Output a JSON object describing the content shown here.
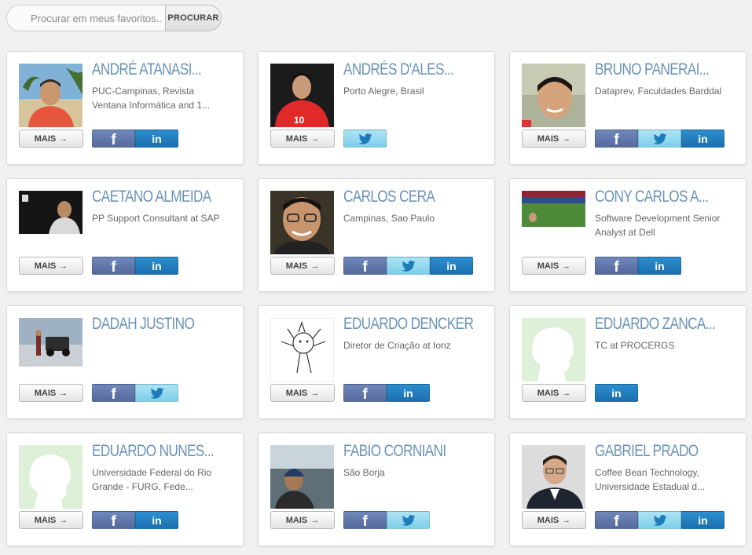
{
  "search": {
    "placeholder": "Procurar em meus favoritos..",
    "button_label": "PROCURAR"
  },
  "more_label": "MAIS",
  "arrow": "→",
  "icons": {
    "facebook": "f",
    "linkedin": "in"
  },
  "colors": {
    "name": "#6a93b8",
    "facebook": "#5f77ad",
    "twitter": "#8ad6ee",
    "linkedin": "#237fc0"
  },
  "profiles": [
    {
      "name": "ANDRÉ ATANASI...",
      "desc": "PUC-Campinas, Revista Ventana Informática and 1...",
      "networks": [
        "facebook",
        "linkedin"
      ],
      "avatar": "photo-beach"
    },
    {
      "name": "ANDRÉS D'ALES...",
      "desc": "Porto Alegre, Brasil",
      "networks": [
        "twitter"
      ],
      "avatar": "photo-red-jersey"
    },
    {
      "name": "BRUNO PANERAI...",
      "desc": "Dataprev, Faculdades Barddal",
      "networks": [
        "facebook",
        "twitter",
        "linkedin"
      ],
      "avatar": "photo-portrait"
    },
    {
      "name": "CAETANO ALMEIDA",
      "desc": "PP Support Consultant at SAP",
      "networks": [
        "facebook",
        "linkedin"
      ],
      "avatar": "photo-night"
    },
    {
      "name": "CARLOS CERA",
      "desc": "Campinas, Sao Paulo",
      "networks": [
        "facebook",
        "twitter",
        "linkedin"
      ],
      "avatar": "photo-glasses"
    },
    {
      "name": "CONY CARLOS A...",
      "desc": "Software Development Senior Analyst at Dell",
      "networks": [
        "facebook",
        "linkedin"
      ],
      "avatar": "photo-stadium"
    },
    {
      "name": "DADAH JUSTINO",
      "desc": "",
      "networks": [
        "facebook",
        "twitter"
      ],
      "avatar": "photo-jeep"
    },
    {
      "name": "EDUARDO DENCKER",
      "desc": "Diretor de Criação at Ionz",
      "networks": [
        "facebook",
        "linkedin"
      ],
      "avatar": "drawing"
    },
    {
      "name": "EDUARDO ZANCA...",
      "desc": "TC at PROCERGS",
      "networks": [
        "linkedin"
      ],
      "avatar": "silhouette"
    },
    {
      "name": "EDUARDO NUNES...",
      "desc": "Universidade Federal do Rio Grande - FURG, Fede...",
      "networks": [
        "facebook",
        "linkedin"
      ],
      "avatar": "silhouette"
    },
    {
      "name": "FABIO CORNIANI",
      "desc": "São Borja",
      "networks": [
        "facebook",
        "twitter"
      ],
      "avatar": "photo-beanie"
    },
    {
      "name": "GABRIEL PRADO",
      "desc": "Coffee Bean Technology, Universidade Estadual d...",
      "networks": [
        "facebook",
        "twitter",
        "linkedin"
      ],
      "avatar": "photo-suit"
    }
  ]
}
